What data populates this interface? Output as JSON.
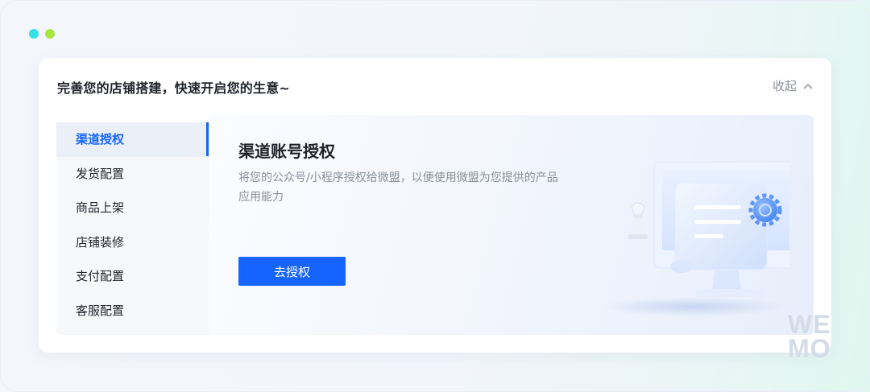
{
  "window": {
    "dot_colors": [
      "#35e1e8",
      "#a6e53c"
    ]
  },
  "card": {
    "title": "完善您的店铺搭建，快速开启您的生意~",
    "collapse_label": "收起",
    "collapse_icon": "chevron-up-icon"
  },
  "sidebar": {
    "items": [
      {
        "label": "渠道授权",
        "active": true
      },
      {
        "label": "发货配置",
        "active": false
      },
      {
        "label": "商品上架",
        "active": false
      },
      {
        "label": "店铺装修",
        "active": false
      },
      {
        "label": "支付配置",
        "active": false
      },
      {
        "label": "客服配置",
        "active": false
      }
    ]
  },
  "panel": {
    "title": "渠道账号授权",
    "description": "将您的公众号/小程序授权给微盟，以便使用微盟为您提供的产品应用能力",
    "button_label": "去授权",
    "illustration": "monitor-document-chess-illustration"
  },
  "watermark": {
    "line1": "WE",
    "line2": "MO"
  },
  "colors": {
    "accent": "#1664ff",
    "text_primary": "#1f2329",
    "text_secondary": "#8a8f99"
  }
}
